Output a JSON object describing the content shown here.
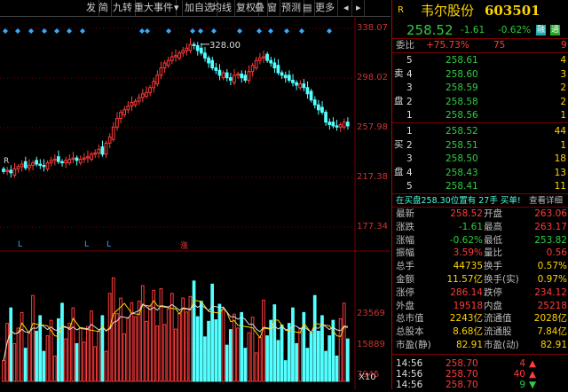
{
  "toolbar": {
    "items": [
      "发",
      "简",
      "九转",
      "重大事件",
      "▾",
      "加自选",
      "均线",
      "复权",
      "叠",
      "窗",
      "预测",
      "▤",
      "更多",
      "◂",
      "▸"
    ]
  },
  "chart": {
    "price_ticks": [
      "338.07",
      "298.02",
      "257.98",
      "217.38",
      "177.34"
    ],
    "volume_ticks": [
      "23569",
      "15889",
      "7945",
      "X10"
    ],
    "annotation_high": "328.00",
    "markers": [
      "R",
      "L",
      "L",
      "L",
      "涨"
    ],
    "colors": {
      "up": "#ff3b3b",
      "down": "#54ffff",
      "ma": "#ffd400",
      "grid": "#7a0000"
    }
  },
  "panel": {
    "r_label": "R",
    "name": "韦尔股份",
    "code": "603501",
    "price": "258.52",
    "change": "-1.61",
    "pct": "-0.62%",
    "badge1": "融",
    "badge2": "通",
    "weibi_label": "委比",
    "weibi_value": "+75.73%",
    "weicha_value": "75",
    "weicha_right": "9",
    "sell_label": [
      "卖",
      "盘"
    ],
    "buy_label": [
      "买",
      "盘"
    ],
    "asks": [
      {
        "lv": "5",
        "price": "258.61",
        "vol": "4"
      },
      {
        "lv": "4",
        "price": "258.60",
        "vol": "3"
      },
      {
        "lv": "3",
        "price": "258.59",
        "vol": "2"
      },
      {
        "lv": "2",
        "price": "258.58",
        "vol": "2"
      },
      {
        "lv": "1",
        "price": "258.56",
        "vol": "1"
      }
    ],
    "bids": [
      {
        "lv": "1",
        "price": "258.52",
        "vol": "44"
      },
      {
        "lv": "2",
        "price": "258.51",
        "vol": "1"
      },
      {
        "lv": "3",
        "price": "258.50",
        "vol": "18"
      },
      {
        "lv": "4",
        "price": "258.43",
        "vol": "13"
      },
      {
        "lv": "5",
        "price": "258.41",
        "vol": "11"
      }
    ],
    "notice": "在买盘258.30位置有 27手 买单!",
    "notice_link": "查看详细",
    "stats": [
      {
        "l1": "最新",
        "v1": "258.52",
        "l2": "开盘",
        "v2": "263.06"
      },
      {
        "l1": "涨跌",
        "v1": "-1.61",
        "l2": "最高",
        "v2": "263.17"
      },
      {
        "l1": "涨幅",
        "v1": "-0.62%",
        "l2": "最低",
        "v2": "253.82"
      },
      {
        "l1": "振幅",
        "v1": "3.59%",
        "l2": "量比",
        "v2": "0.56"
      },
      {
        "l1": "总手",
        "v1": "44735",
        "l2": "换手",
        "v2": "0.57%"
      },
      {
        "l1": "金额",
        "v1": "11.57亿",
        "l2": "换手(实)",
        "v2": "0.97%"
      },
      {
        "l1": "涨停",
        "v1": "286.14",
        "l2": "跌停",
        "v2": "234.12"
      },
      {
        "l1": "外盘",
        "v1": "19518",
        "l2": "内盘",
        "v2": "25218"
      },
      {
        "l1": "总市值",
        "v1": "2243亿",
        "l2": "流通值",
        "v2": "2028亿"
      },
      {
        "l1": "总股本",
        "v1": "8.68亿",
        "l2": "流通股",
        "v2": "7.84亿"
      },
      {
        "l1": "市盈(静)",
        "v1": "82.91",
        "l2": "市盈(动)",
        "v2": "82.91"
      }
    ],
    "ticks": [
      {
        "t": "14:56",
        "p": "258.70",
        "v": "4"
      },
      {
        "t": "14:56",
        "p": "258.70",
        "v": "40"
      },
      {
        "t": "14:56",
        "p": "258.70",
        "v": "9"
      }
    ]
  }
}
